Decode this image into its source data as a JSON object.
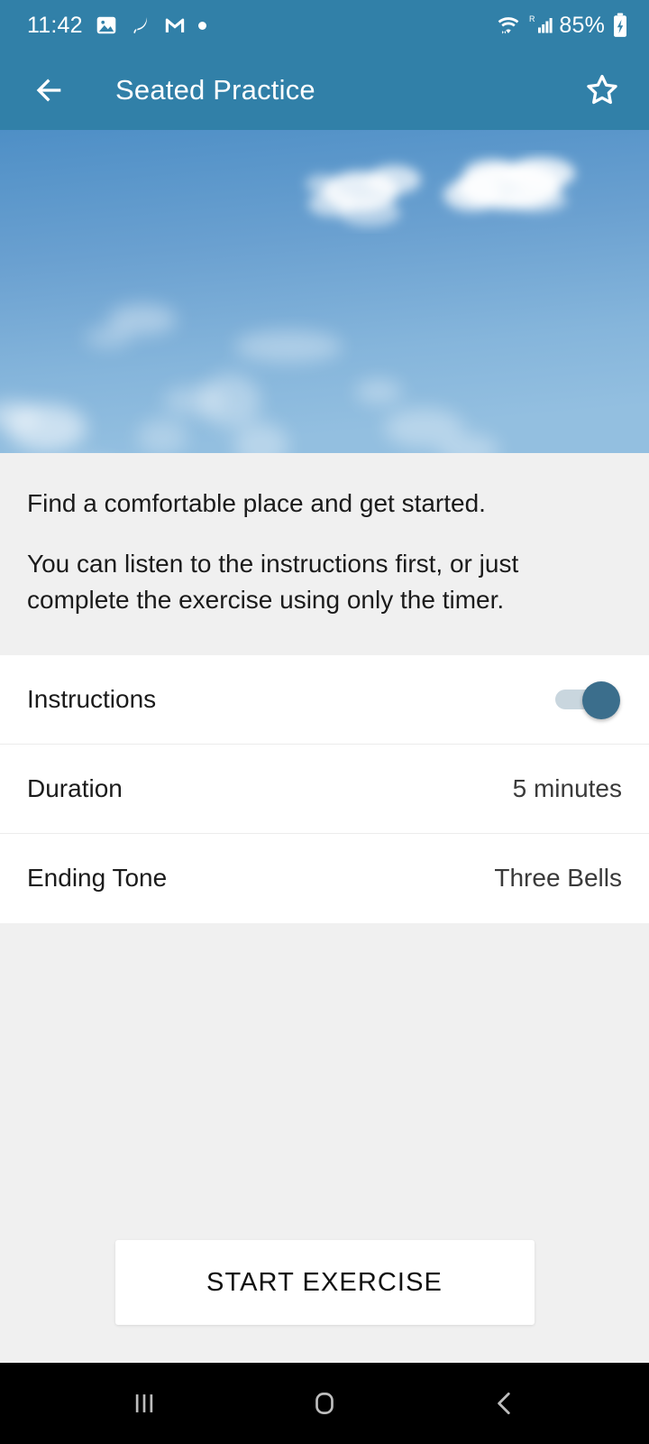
{
  "status_bar": {
    "time": "11:42",
    "battery_percent": "85%",
    "network_label": "R",
    "icons": [
      "gallery-icon",
      "leaf-icon",
      "gmail-icon",
      "dot-icon",
      "wifi-icon",
      "signal-icon",
      "battery-charging-icon"
    ],
    "background_color": "#3180a8"
  },
  "app_bar": {
    "title": "Seated Practice",
    "back_icon": "back-arrow-icon",
    "favorite_icon": "star-outline-icon",
    "background_color": "#3180a8"
  },
  "hero": {
    "alt": "blue sky with wispy clouds"
  },
  "description": {
    "line1": "Find a comfortable place and get started.",
    "line2": "You can listen to the instructions first, or just complete the exercise using only the timer."
  },
  "settings": {
    "rows": [
      {
        "label": "Instructions",
        "value": "",
        "type": "toggle",
        "checked": true
      },
      {
        "label": "Duration",
        "value": "5 minutes",
        "type": "value"
      },
      {
        "label": "Ending Tone",
        "value": "Three Bells",
        "type": "value"
      }
    ]
  },
  "cta": {
    "label": "START EXERCISE"
  },
  "nav_bar": {
    "recents_icon": "recents-icon",
    "home_icon": "home-icon",
    "back_icon": "nav-back-icon"
  },
  "colors": {
    "accent": "#3180a8",
    "toggle_thumb": "#3b6e8c",
    "toggle_track": "#c9d6de",
    "page_bg": "#f0f0f0"
  }
}
